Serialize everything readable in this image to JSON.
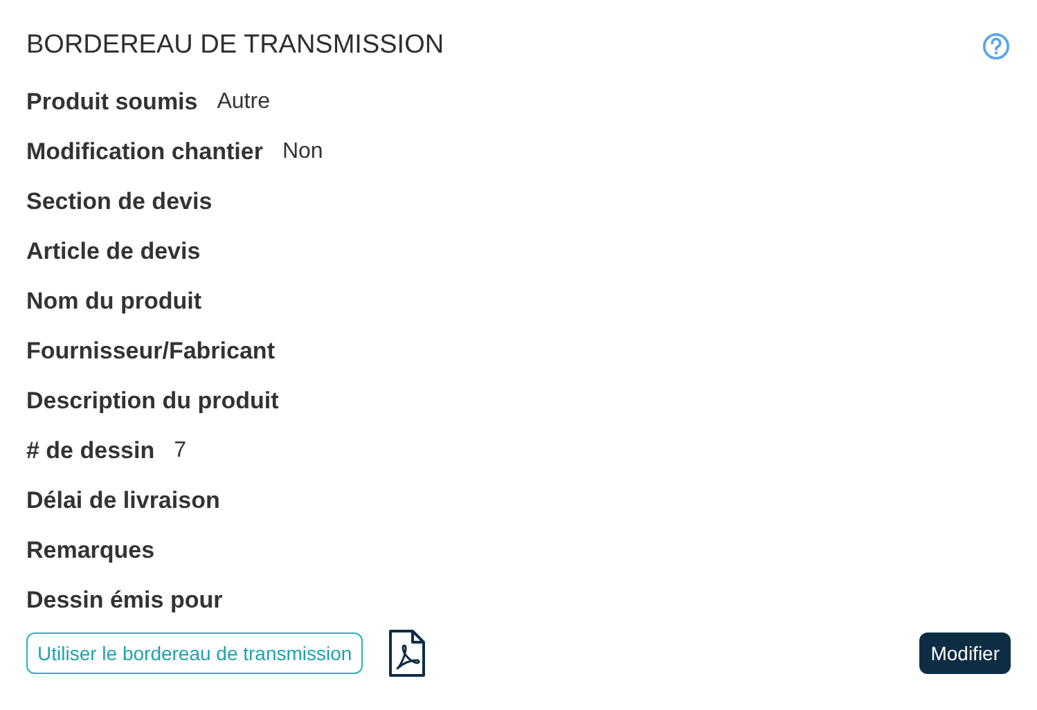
{
  "title": "BORDEREAU DE TRANSMISSION",
  "fields": [
    {
      "label": "Produit soumis",
      "value": "Autre"
    },
    {
      "label": "Modification chantier",
      "value": "Non"
    },
    {
      "label": "Section de devis"
    },
    {
      "label": "Article de devis"
    },
    {
      "label": "Nom du produit"
    },
    {
      "label": "Fournisseur/Fabricant"
    },
    {
      "label": "Description du produit"
    },
    {
      "label": "# de dessin",
      "value": "7"
    },
    {
      "label": "Délai de livraison"
    },
    {
      "label": "Remarques"
    },
    {
      "label": "Dessin émis pour"
    }
  ],
  "use_button": "Utiliser le bordereau de transmission",
  "edit_button": "Modifier"
}
